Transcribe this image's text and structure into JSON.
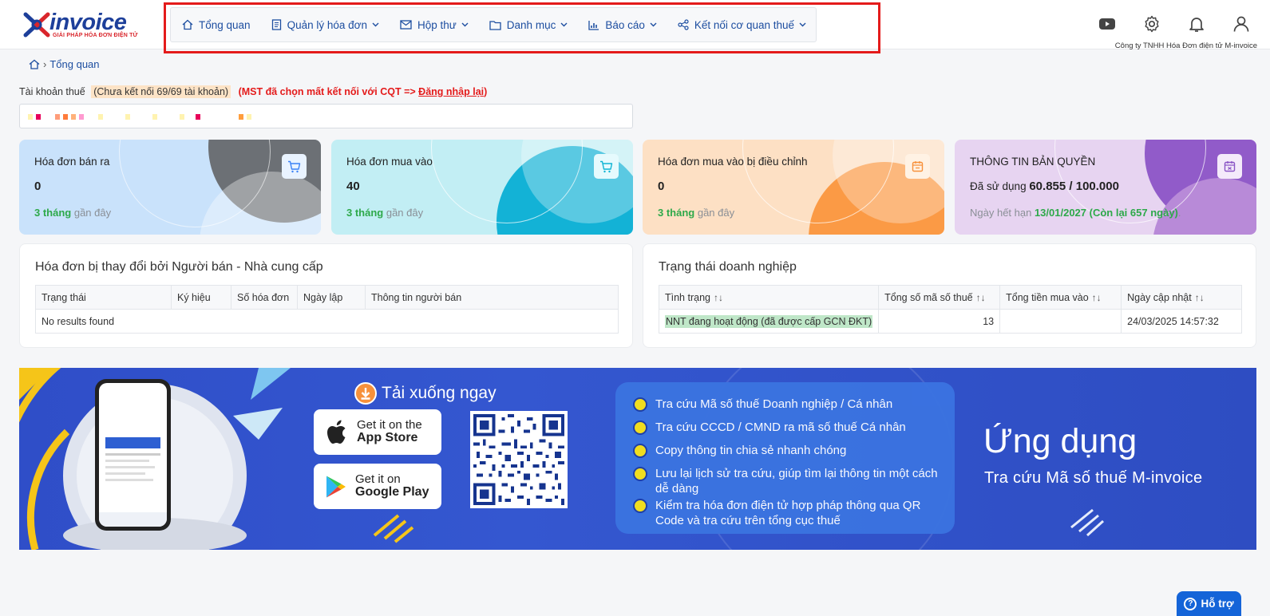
{
  "brand": {
    "name": "invoice",
    "tagline": "GIẢI PHÁP HÓA ĐƠN ĐIỆN TỬ"
  },
  "nav": [
    {
      "label": "Tổng quan",
      "icon": "home-icon",
      "dropdown": false
    },
    {
      "label": "Quản lý hóa đơn",
      "icon": "document-icon",
      "dropdown": true
    },
    {
      "label": "Hộp thư",
      "icon": "mail-icon",
      "dropdown": true
    },
    {
      "label": "Danh mục",
      "icon": "folder-icon",
      "dropdown": true
    },
    {
      "label": "Báo cáo",
      "icon": "chart-icon",
      "dropdown": true
    },
    {
      "label": "Kết nối cơ quan thuế",
      "icon": "share-icon",
      "dropdown": true
    }
  ],
  "header": {
    "company": "Công ty TNHH Hóa Đơn điện tử M-invoice"
  },
  "breadcrumb": {
    "current": "Tổng quan"
  },
  "tax_account": {
    "label": "Tài khoản thuế",
    "status": "(Chưa kết nối 69/69 tài khoản)",
    "warning_prefix": "(MST đã chọn mất kết nối với CQT =>",
    "warning_link": "Đăng nhập lại",
    "warning_suffix": ")"
  },
  "cards": [
    {
      "title": "Hóa đơn bán ra",
      "value": "0",
      "note_highlight": "3 tháng",
      "note_rest": " gần đây",
      "icon": "cart-icon",
      "accent": "#3b82f6"
    },
    {
      "title": "Hóa đơn mua vào",
      "value": "40",
      "note_highlight": "3 tháng",
      "note_rest": " gần đây",
      "icon": "cart-icon",
      "accent": "#0fb4d4"
    },
    {
      "title": "Hóa đơn mua vào bị điều chỉnh",
      "value": "0",
      "note_highlight": "3 tháng",
      "note_rest": " gần đây",
      "icon": "calendar-icon",
      "accent": "#f7913b"
    },
    {
      "title": "THÔNG TIN BẢN QUYỀN",
      "value_prefix": "Đã sử dụng ",
      "value": "60.855 / 100.000",
      "note_prefix": "Ngày hết hạn ",
      "note_highlight": "13/01/2027 (Còn lại 657 ngày)",
      "note_rest": ".",
      "icon": "calendar-icon",
      "accent": "#8b55c6"
    }
  ],
  "seller_panel": {
    "title": "Hóa đơn bị thay đổi bởi Người bán - Nhà cung cấp",
    "columns": [
      "Trạng thái",
      "Ký hiệu",
      "Số hóa đơn",
      "Ngày lập",
      "Thông tin người bán"
    ],
    "empty": "No results found"
  },
  "business_panel": {
    "title": "Trạng thái doanh nghiệp",
    "columns": [
      "Tình trạng",
      "Tổng số mã số thuế",
      "Tổng tiền mua vào",
      "Ngày cập nhật"
    ],
    "rows": [
      {
        "status": "NNT đang hoạt động (đã được cấp GCN ĐKT)",
        "count": "13",
        "amount": "",
        "updated": "24/03/2025 14:57:32"
      }
    ]
  },
  "banner": {
    "download_title": "Tải xuống ngay",
    "app_store_line1": "Get it on the",
    "app_store_line2": "App Store",
    "google_play_line1": "Get it on",
    "google_play_line2": "Google Play",
    "features": [
      "Tra cứu Mã số thuế Doanh nghiệp / Cá nhân",
      "Tra cứu CCCD / CMND ra mã số thuế Cá nhân",
      "Copy thông tin chia sẻ nhanh chóng",
      "Lưu lại lịch sử tra cứu, giúp tìm lại thông tin một cách dễ dàng",
      "Kiểm tra hóa đơn điện tử hợp pháp thông qua QR Code và tra cứu trên tổng cục thuế"
    ],
    "app_title": "Ứng dụng",
    "app_subtitle": "Tra cứu Mã số thuế M-invoice"
  },
  "support": {
    "label": "Hỗ trợ"
  }
}
